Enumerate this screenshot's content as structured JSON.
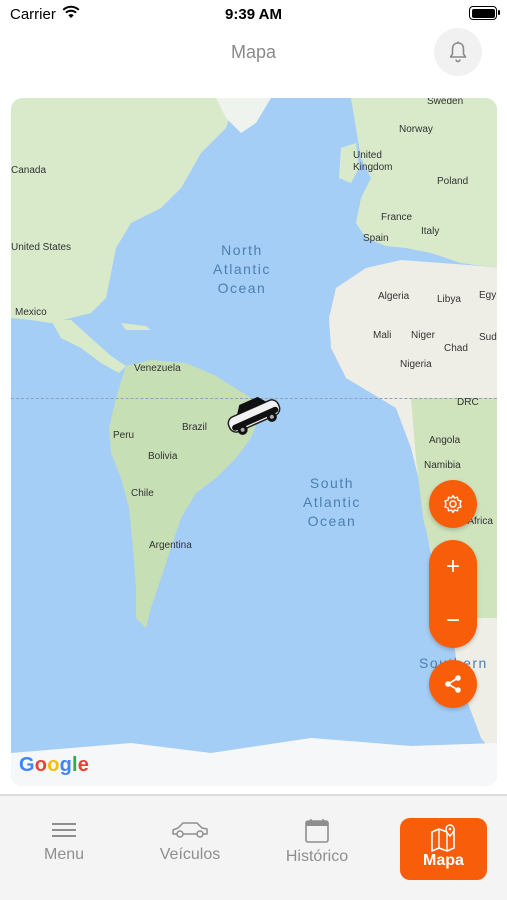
{
  "status_bar": {
    "carrier": "Carrier",
    "time": "9:39 AM"
  },
  "header": {
    "title": "Mapa"
  },
  "map": {
    "labels": {
      "sweden": "Sweden",
      "norway": "Norway",
      "uk": "United\nKingdom",
      "poland": "Poland",
      "france": "France",
      "italy": "Italy",
      "spain": "Spain",
      "canada": "Canada",
      "united_states": "United States",
      "mexico": "Mexico",
      "algeria": "Algeria",
      "libya": "Libya",
      "egypt": "Egy",
      "mali": "Mali",
      "niger": "Niger",
      "chad": "Chad",
      "sudan": "Sud",
      "nigeria": "Nigeria",
      "venezuela": "Venezuela",
      "brazil": "Brazil",
      "peru": "Peru",
      "bolivia": "Bolivia",
      "drc": "DRC",
      "angola": "Angola",
      "namibia": "Namibia",
      "chile": "Chile",
      "argentina": "Argentina",
      "south_africa": "South Africa"
    },
    "oceans": {
      "north_atlantic": "North\nAtlantic\nOcean",
      "south_atlantic": "South\nAtlantic\nOcean",
      "southern": "Southern\nOcean"
    },
    "zoom_in": "+",
    "zoom_out": "−",
    "attribution": "Google"
  },
  "nav": {
    "items": [
      {
        "label": "Menu",
        "icon": "menu-icon"
      },
      {
        "label": "Veículos",
        "icon": "car-icon"
      },
      {
        "label": "Histórico",
        "icon": "calendar-icon"
      },
      {
        "label": "Mapa",
        "icon": "map-icon",
        "active": true
      }
    ]
  },
  "colors": {
    "accent": "#f85e0a",
    "water": "#a5cef6",
    "land": "#d9eacb"
  }
}
